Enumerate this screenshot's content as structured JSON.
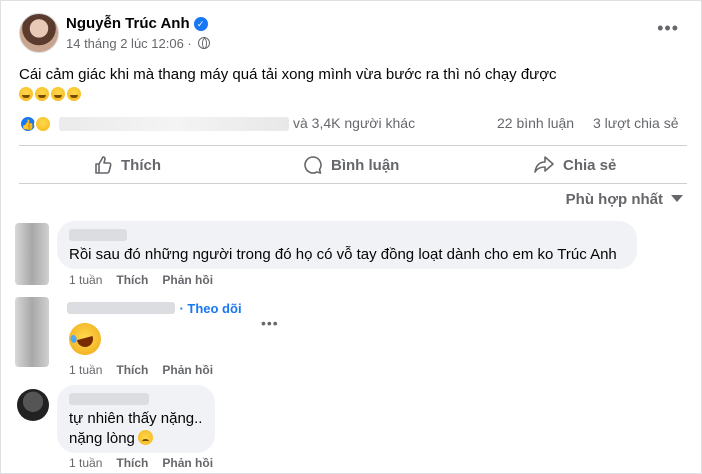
{
  "post": {
    "author": "Nguyễn Trúc Anh",
    "timestamp": "14 tháng 2 lúc 12:06 ·",
    "text": "Cái cảm giác khi mà thang máy quá tải xong mình vừa bước ra thì nó chạy được",
    "icons": {
      "audience": "globe-icon",
      "verified": "verified-badge-icon",
      "more": "more-options-icon"
    }
  },
  "stats": {
    "reactions": "và 3,4K người khác",
    "comments": "22 bình luận",
    "shares": "3 lượt chia sẻ"
  },
  "actions": {
    "like": "Thích",
    "comment": "Bình luận",
    "share": "Chia sẻ"
  },
  "sort": {
    "label": "Phù hợp nhất"
  },
  "comments": [
    {
      "text": "Rồi sau đó những người trong đó họ có vỗ tay đồng loạt dành cho em ko Trúc Anh",
      "time": "1 tuần",
      "like": "Thích",
      "reply": "Phản hồi"
    },
    {
      "follow": "· Theo dõi",
      "time": "1 tuần",
      "like": "Thích",
      "reply": "Phản hồi",
      "emoji": "laughing-crying-emoji"
    },
    {
      "text_line1": "tự nhiên thấy nặng..",
      "text_line2": "nặng lòng",
      "time": "1 tuần",
      "like": "Thích",
      "reply": "Phản hồi"
    }
  ],
  "colors": {
    "accent": "#1877f2",
    "secondary_text": "#65676b",
    "bubble": "#f0f2f5"
  }
}
